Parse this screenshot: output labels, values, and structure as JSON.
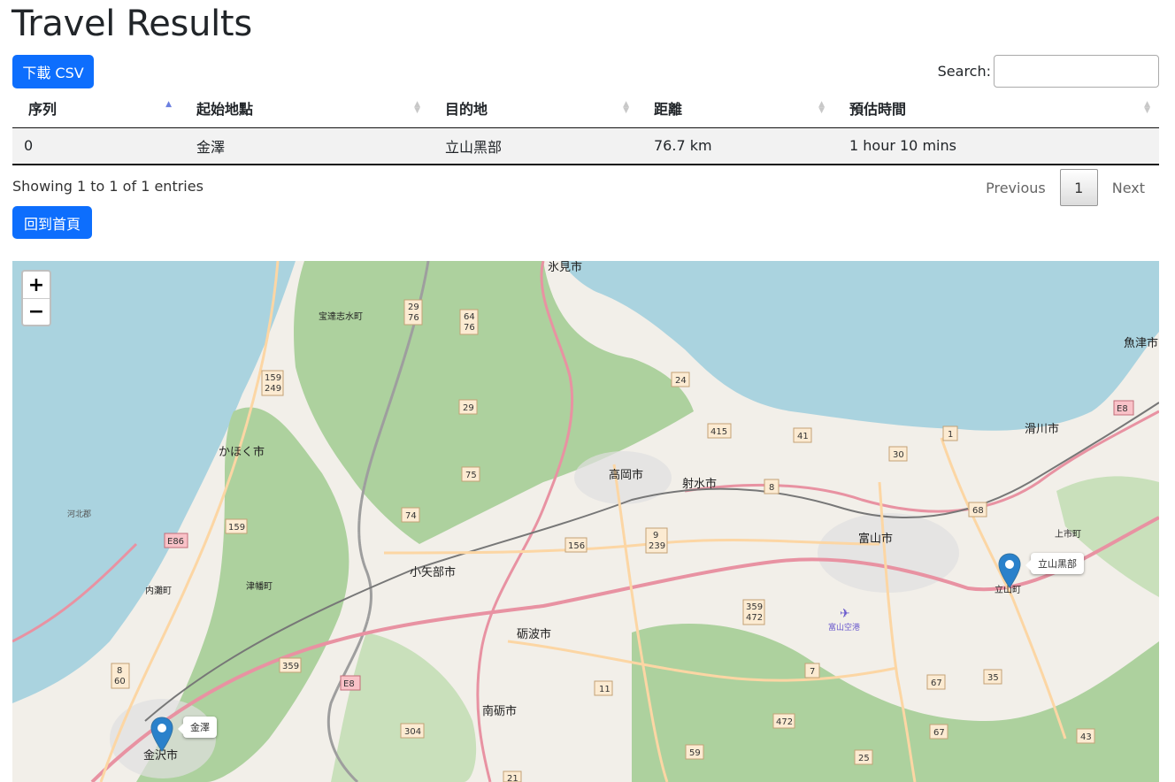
{
  "page": {
    "title": "Travel Results",
    "download_csv_label": "下載 CSV",
    "home_label": "回到首頁"
  },
  "search": {
    "label": "Search:",
    "value": "",
    "placeholder": ""
  },
  "table": {
    "columns": [
      "序列",
      "起始地點",
      "目的地",
      "距離",
      "預估時間"
    ],
    "sort_column": "序列",
    "rows": [
      [
        "0",
        "金澤",
        "立山黑部",
        "76.7 km",
        "1 hour 10 mins"
      ]
    ]
  },
  "info_text": "Showing 1 to 1 of 1 entries",
  "pagination": {
    "previous": "Previous",
    "current": "1",
    "next": "Next"
  },
  "map": {
    "zoom_in": "+",
    "zoom_out": "−",
    "markers": [
      {
        "label": "金澤"
      },
      {
        "label": "立山黑部"
      }
    ],
    "places": [
      "氷見市",
      "宝達志水町",
      "かほく市",
      "河北郡",
      "内灘町",
      "津幡町",
      "小矢部市",
      "砺波市",
      "南砺市",
      "金沢市",
      "高岡市",
      "射水市",
      "富山市",
      "富山空港",
      "滑川市",
      "上市町",
      "立山町",
      "魚津市"
    ],
    "route_shields": [
      "29 76",
      "64 76",
      "159 249",
      "29",
      "75",
      "74",
      "159",
      "E86",
      "359",
      "8 60",
      "E8",
      "304",
      "156",
      "9 239",
      "24",
      "415",
      "41",
      "1",
      "30",
      "8",
      "68",
      "E8",
      "11",
      "59",
      "472",
      "7",
      "67",
      "35",
      "43",
      "25",
      "21",
      "359 472"
    ],
    "colors": {
      "water": "#aad3df",
      "land": "#f2efe9",
      "forest": "#add19e",
      "motorway": "#e892a2",
      "primary": "#fcd6a4",
      "marker": "#2a81cb"
    }
  }
}
